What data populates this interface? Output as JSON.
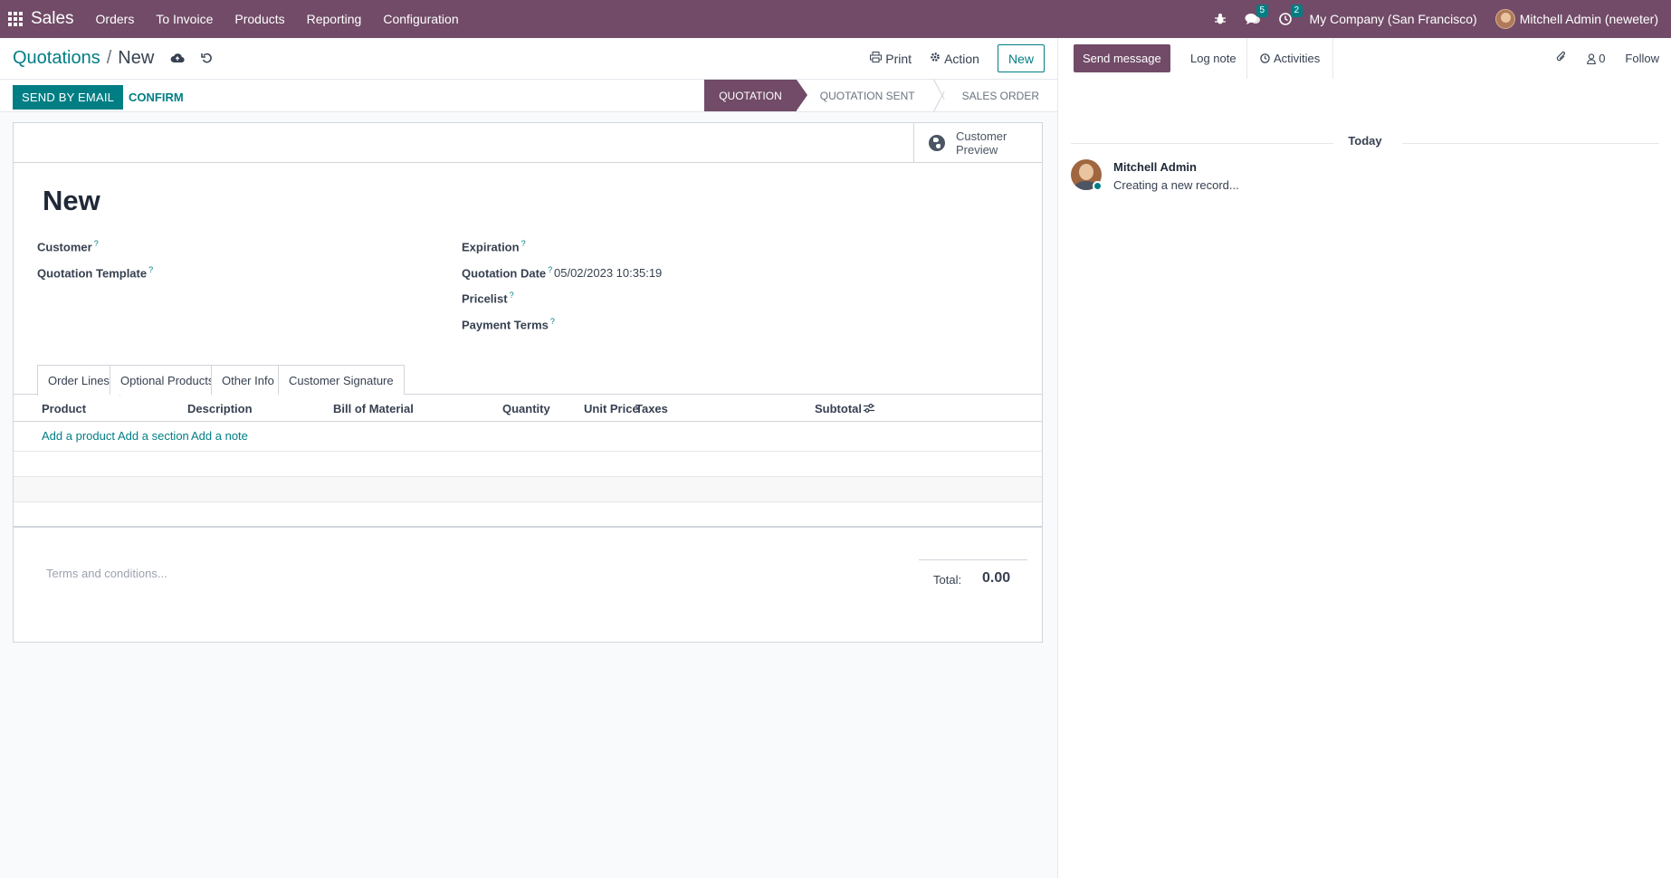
{
  "navbar": {
    "brand": "Sales",
    "menu": [
      "Orders",
      "To Invoice",
      "Products",
      "Reporting",
      "Configuration"
    ],
    "messages_count": "5",
    "activities_count": "2",
    "company": "My Company (San Francisco)",
    "user": "Mitchell Admin (neweter)",
    "accent_color": "#714B67"
  },
  "control_panel": {
    "breadcrumb_parent": "Quotations",
    "breadcrumb_sep": "/",
    "breadcrumb_current": "New",
    "print_label": "Print",
    "action_label": "Action",
    "new_label": "New"
  },
  "header_buttons": {
    "send_email": "SEND BY EMAIL",
    "confirm": "CONFIRM"
  },
  "statusbar": [
    "QUOTATION",
    "QUOTATION SENT",
    "SALES ORDER"
  ],
  "form": {
    "preview_label": "Customer Preview",
    "title": "New",
    "customer_label": "Customer",
    "template_label": "Quotation Template",
    "expiration_label": "Expiration",
    "date_label": "Quotation Date",
    "date_value": "05/02/2023 10:35:19",
    "pricelist_label": "Pricelist",
    "terms_label": "Payment Terms",
    "help_mark": "?"
  },
  "tabs": [
    "Order Lines",
    "Optional Products",
    "Other Info",
    "Customer Signature"
  ],
  "order_lines": {
    "columns": [
      "Product",
      "Description",
      "Bill of Material",
      "Quantity",
      "Unit Price",
      "Taxes",
      "Subtotal"
    ],
    "add_links": [
      "Add a product",
      "Add a section",
      "Add a note"
    ]
  },
  "footer": {
    "terms_placeholder": "Terms and conditions...",
    "total_label": "Total:",
    "total_value": "0.00"
  },
  "chatter": {
    "send_message": "Send message",
    "log_note": "Log note",
    "activities": "Activities",
    "followers_count": "0",
    "follow": "Follow",
    "today": "Today",
    "message_author": "Mitchell Admin",
    "message_body": "Creating a new record..."
  }
}
